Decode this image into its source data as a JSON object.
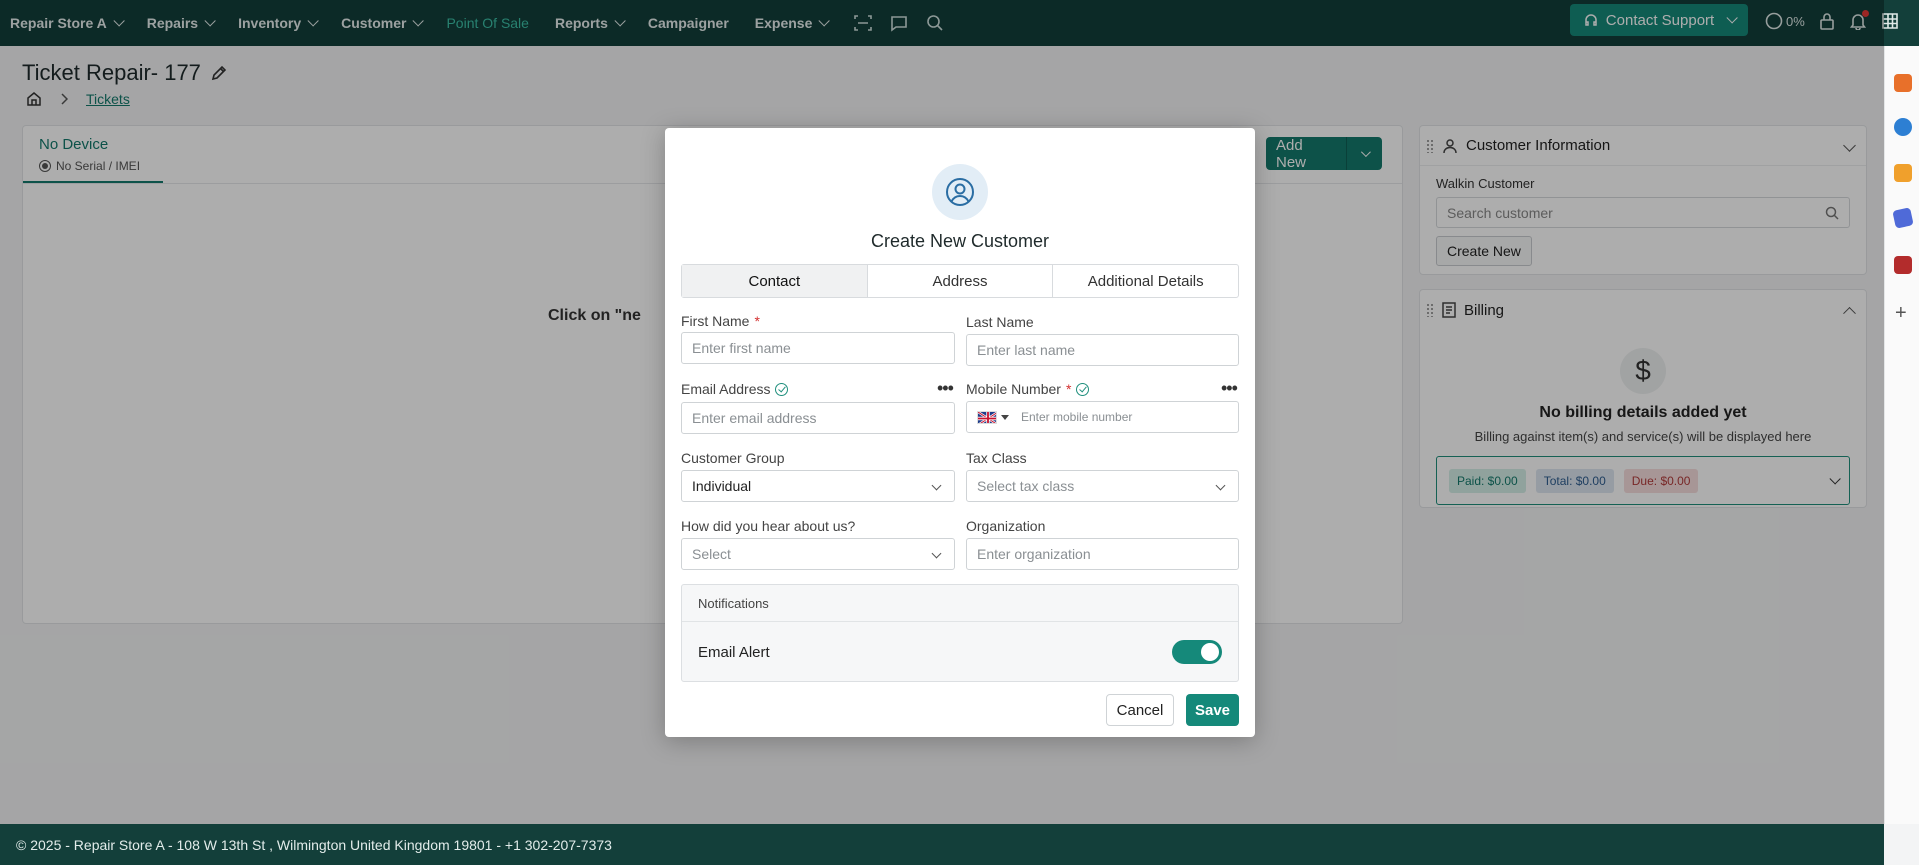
{
  "nav": {
    "items": [
      {
        "label": "Repair Store A",
        "dropdown": true,
        "active": false
      },
      {
        "label": "Repairs",
        "dropdown": true,
        "active": false
      },
      {
        "label": "Inventory",
        "dropdown": true,
        "active": false
      },
      {
        "label": "Customer",
        "dropdown": true,
        "active": false
      },
      {
        "label": "Point Of Sale",
        "dropdown": false,
        "active": true
      },
      {
        "label": "Reports",
        "dropdown": true,
        "active": false
      },
      {
        "label": "Campaigner",
        "dropdown": false,
        "active": false
      },
      {
        "label": "Expense",
        "dropdown": true,
        "active": false
      }
    ],
    "icons": [
      "scan-icon",
      "chat-icon",
      "search-icon"
    ],
    "support_label": "Contact Support",
    "progress_label": "0%",
    "right_icons": [
      "lock-icon",
      "bell-icon",
      "apps-grid-icon"
    ]
  },
  "page": {
    "title": "Ticket Repair- 177",
    "breadcrumb_link": "Tickets"
  },
  "device_tab": {
    "title": "No Device",
    "serial": "No Serial / IMEI"
  },
  "main": {
    "click_text": "Click on \"ne",
    "add_new_label": "Add New"
  },
  "customer_card": {
    "title": "Customer Information",
    "walkin": "Walkin Customer",
    "search_placeholder": "Search customer",
    "create_new_label": "Create New"
  },
  "billing_card": {
    "title": "Billing",
    "icon_glyph": "$",
    "empty_title": "No billing details added yet",
    "empty_sub": "Billing against item(s) and service(s) will be displayed here",
    "paid": "Paid: $0.00",
    "total": "Total: $0.00",
    "due": "Due: $0.00"
  },
  "footer": {
    "text": "© 2025 - Repair Store A - 108 W 13th St , Wilmington United Kingdom 19801 - +1 302-207-7373"
  },
  "modal": {
    "title": "Create New Customer",
    "tabs": [
      "Contact",
      "Address",
      "Additional Details"
    ],
    "active_tab": "Contact",
    "fields": {
      "first_name_label": "First Name",
      "first_name_placeholder": "Enter first name",
      "last_name_label": "Last Name",
      "last_name_placeholder": "Enter last name",
      "email_label": "Email Address",
      "email_placeholder": "Enter email address",
      "mobile_label": "Mobile Number",
      "mobile_placeholder": "Enter mobile number",
      "customer_group_label": "Customer Group",
      "customer_group_value": "Individual",
      "tax_class_label": "Tax Class",
      "tax_class_placeholder": "Select tax class",
      "hear_label": "How did you hear about us?",
      "hear_placeholder": "Select",
      "organization_label": "Organization",
      "organization_placeholder": "Enter organization"
    },
    "notifications": {
      "heading": "Notifications",
      "email_alert_label": "Email Alert",
      "email_alert_on": true
    },
    "cancel_label": "Cancel",
    "save_label": "Save"
  },
  "colors": {
    "nav_bg": "#133f3a",
    "accent": "#15897a",
    "active_nav": "#3cbfa6"
  }
}
